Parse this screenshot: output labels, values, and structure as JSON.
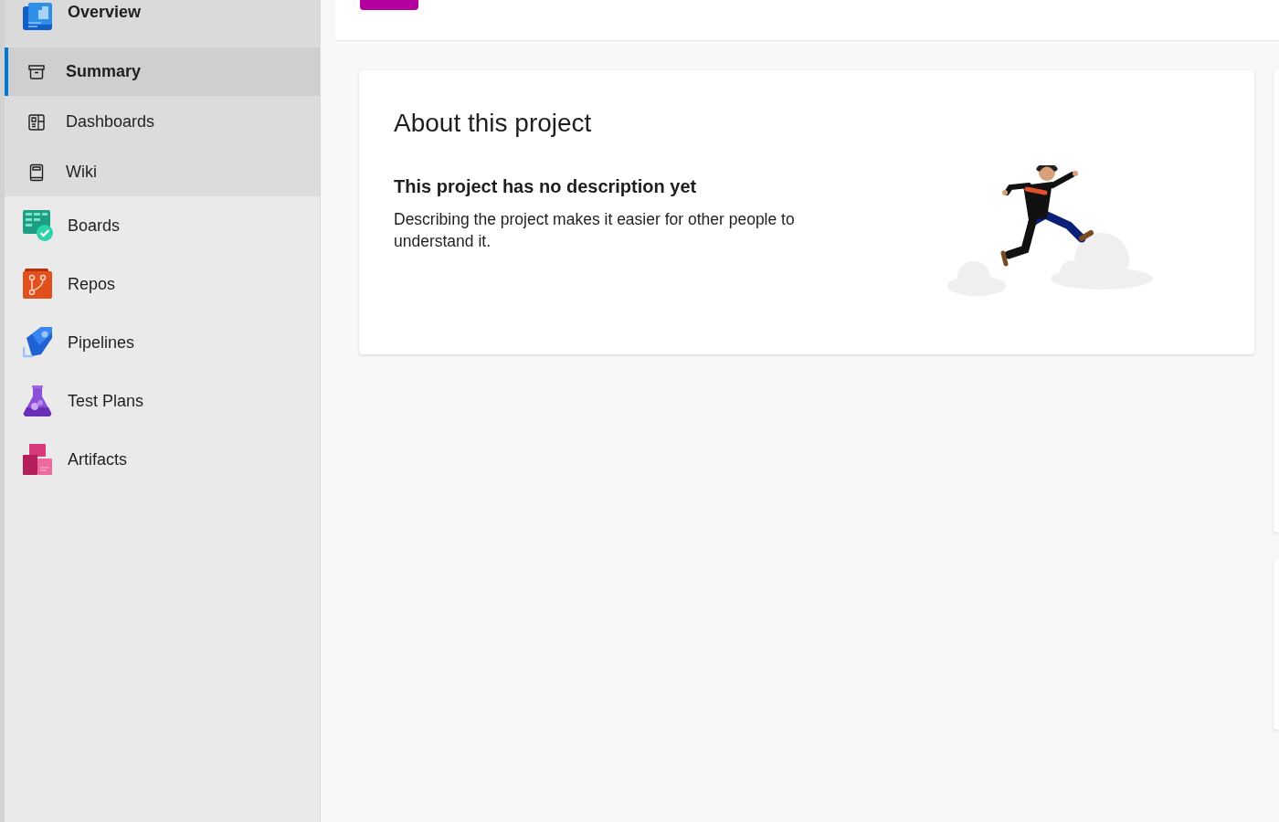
{
  "sidebar": {
    "items": [
      {
        "label": "Overview",
        "kind": "overview",
        "expanded": true,
        "children": [
          {
            "label": "Summary",
            "kind": "summary",
            "selected": true
          },
          {
            "label": "Dashboards",
            "kind": "dashboards",
            "selected": false
          },
          {
            "label": "Wiki",
            "kind": "wiki",
            "selected": false
          }
        ]
      },
      {
        "label": "Boards",
        "kind": "boards",
        "selected": false
      },
      {
        "label": "Repos",
        "kind": "repos",
        "selected": false
      },
      {
        "label": "Pipelines",
        "kind": "pipelines",
        "selected": false
      },
      {
        "label": "Test Plans",
        "kind": "testplans",
        "selected": false
      },
      {
        "label": "Artifacts",
        "kind": "artifacts",
        "selected": false
      }
    ]
  },
  "about_card": {
    "title": "About this project",
    "subtitle": "This project has no description yet",
    "description": "Describing the project makes it easier for other people to understand it."
  }
}
